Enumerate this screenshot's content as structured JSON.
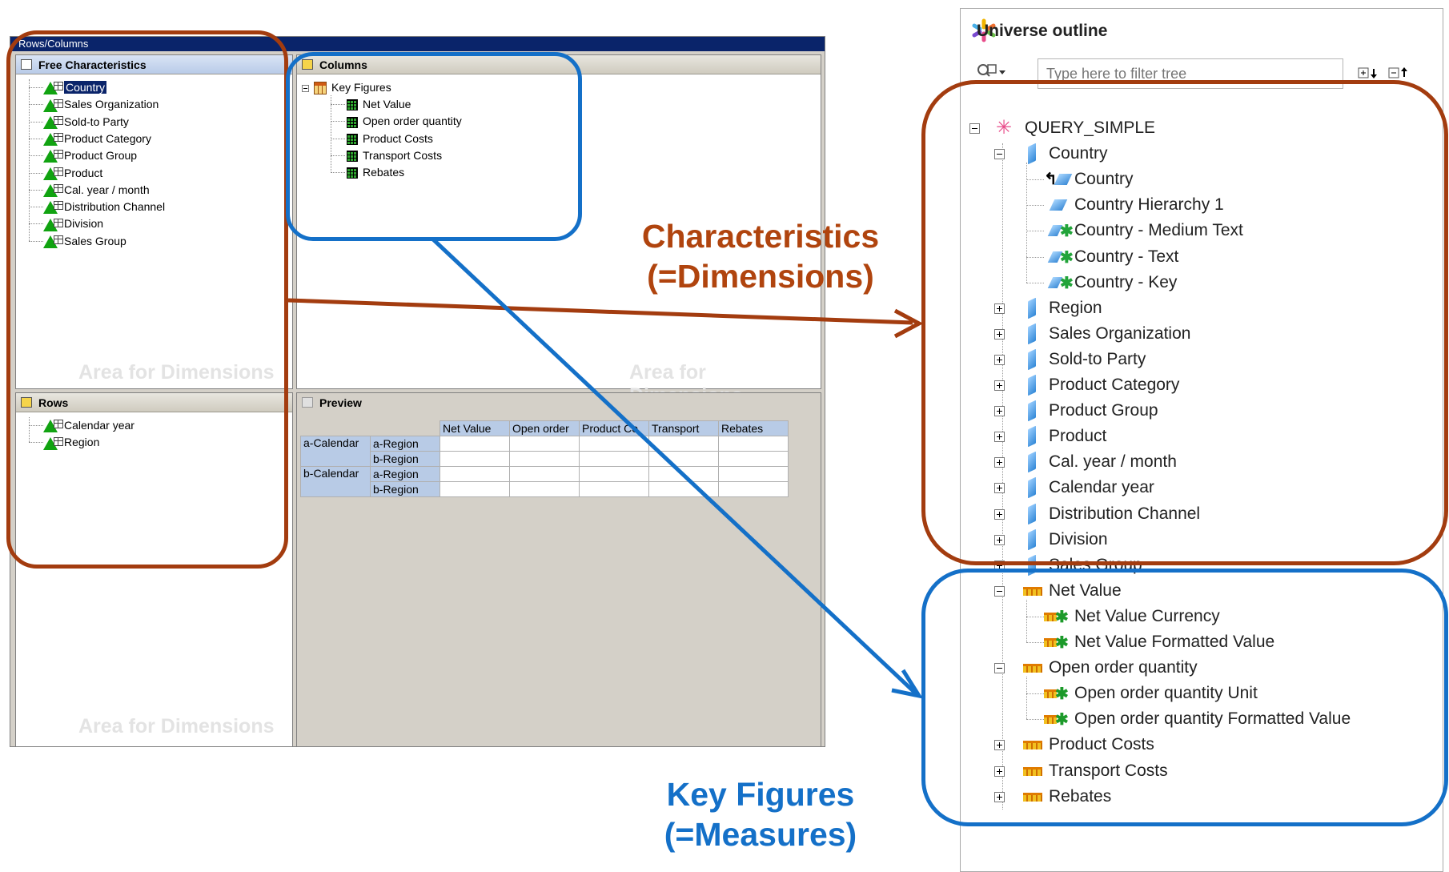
{
  "bex": {
    "window_title": "Rows/Columns",
    "free_characteristics": {
      "header": "Free Characteristics",
      "items": [
        "Country",
        "Sales Organization",
        "Sold-to Party",
        "Product Category",
        "Product Group",
        "Product",
        "Cal. year / month",
        "Distribution Channel",
        "Division",
        "Sales Group"
      ],
      "selected": "Country"
    },
    "columns": {
      "header": "Columns",
      "root": "Key Figures",
      "items": [
        "Net Value",
        "Open order quantity",
        "Product Costs",
        "Transport Costs",
        "Rebates"
      ]
    },
    "rows": {
      "header": "Rows",
      "items": [
        "Calendar year",
        "Region"
      ]
    },
    "preview": {
      "header": "Preview",
      "column_headers": [
        "Net Value",
        "Open order",
        "Product Co",
        "Transport",
        "Rebates"
      ],
      "row_groups": [
        {
          "label": "a-Calendar",
          "regions": [
            "a-Region",
            "b-Region"
          ]
        },
        {
          "label": "b-Calendar",
          "regions": [
            "a-Region",
            "b-Region"
          ]
        }
      ]
    },
    "watermark": "Area for Dimensions"
  },
  "universe_outline": {
    "title": "Universe outline",
    "filter_placeholder": "Type here to filter tree",
    "root": "QUERY_SIMPLE",
    "country": {
      "label": "Country",
      "children": [
        "Country",
        "Country Hierarchy 1",
        "Country - Medium Text",
        "Country - Text",
        "Country - Key"
      ]
    },
    "dimensions": [
      "Region",
      "Sales Organization",
      "Sold-to Party",
      "Product Category",
      "Product Group",
      "Product",
      "Cal. year / month",
      "Calendar year",
      "Distribution Channel",
      "Division",
      "Sales Group"
    ],
    "net_value": {
      "label": "Net Value",
      "children": [
        "Net Value Currency",
        "Net Value Formatted Value"
      ]
    },
    "open_order": {
      "label": "Open order quantity",
      "children": [
        "Open order quantity Unit",
        "Open order quantity Formatted Value"
      ]
    },
    "measures": [
      "Product Costs",
      "Transport Costs",
      "Rebates"
    ]
  },
  "annotations": {
    "characteristics_line1": "Characteristics",
    "characteristics_line2": "(=Dimensions)",
    "key_figures_line1": "Key Figures",
    "key_figures_line2": "(=Measures)"
  },
  "colors": {
    "characteristics": "#a33c0f",
    "key_figures": "#1470c8"
  }
}
